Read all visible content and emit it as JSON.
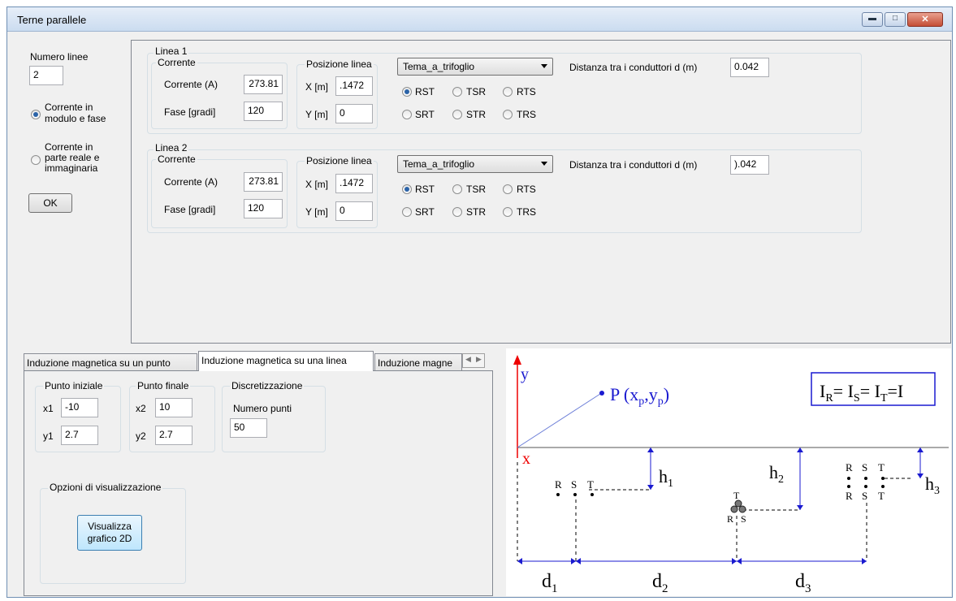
{
  "window": {
    "title": "Terne parallele"
  },
  "left": {
    "num_lines_label": "Numero linee",
    "num_lines_value": "2",
    "radio1_label_l1": "Corrente in",
    "radio1_label_l2": "modulo e fase",
    "radio2_label_l1": "Corrente in",
    "radio2_label_l2": "parte reale e",
    "radio2_label_l3": "immaginaria",
    "ok_label": "OK"
  },
  "lines": [
    {
      "title": "Linea 1",
      "corrente_group": "Corrente",
      "corrente_label": "Corrente (A)",
      "corrente_value": "273.81",
      "fase_label": "Fase [gradi]",
      "fase_value": "120",
      "pos_group": "Posizione linea",
      "x_label": "X [m]",
      "x_value": "‪.1472",
      "y_label": "Y [m]",
      "y_value": "0",
      "combo_value": "Tema_a_trifoglio",
      "dist_label": "Distanza tra i conduttori d (m)",
      "dist_value": "0.042",
      "opts": [
        "RST",
        "TSR",
        "RTS",
        "SRT",
        "STR",
        "TRS"
      ]
    },
    {
      "title": "Linea 2",
      "corrente_group": "Corrente",
      "corrente_label": "Corrente (A)",
      "corrente_value": "273.81",
      "fase_label": "Fase [gradi]",
      "fase_value": "120",
      "pos_group": "Posizione linea",
      "x_label": "X [m]",
      "x_value": "‪.1472",
      "y_label": "Y [m]",
      "y_value": "0",
      "combo_value": "Tema_a_trifoglio",
      "dist_label": "Distanza tra i conduttori d (m)",
      "dist_value": ").042",
      "opts": [
        "RST",
        "TSR",
        "RTS",
        "SRT",
        "STR",
        "TRS"
      ]
    }
  ],
  "tabs": [
    "Induzione magnetica su un punto",
    "Induzione magnetica su una linea",
    "Induzione magne"
  ],
  "tab_panel": {
    "start_group": "Punto iniziale",
    "x1_label": "x1",
    "x1_value": "-10",
    "y1_label": "y1",
    "y1_value": "2.7",
    "end_group": "Punto finale",
    "x2_label": "x2",
    "x2_value": "10",
    "y2_label": "y2",
    "y2_value": "2.7",
    "disc_group": "Discretizzazione",
    "num_points_label": "Numero punti",
    "num_points_value": "50",
    "vis_group": "Opzioni di visualizzazione",
    "vis_button_l1": "Visualizza",
    "vis_button_l2": "grafico 2D"
  },
  "diagram": {
    "y_axis": "y",
    "x_axis": "x",
    "point": "P (x",
    "point_sub1": "p",
    "point_mid": ",y",
    "point_sub2": "p",
    "point_end": ")",
    "eq": "I",
    "h1": "h",
    "h2": "h",
    "h3": "h",
    "d1": "d",
    "d2": "d",
    "d3": "d",
    "sub1": "1",
    "sub2": "2",
    "sub3": "3",
    "R": "R",
    "S": "S",
    "T": "T",
    "eq_R": "R",
    "eq_S": "S",
    "eq_T": "T",
    "eq_mid1": "= I",
    "eq_mid2": "= I",
    "eq_mid3": "=I"
  }
}
